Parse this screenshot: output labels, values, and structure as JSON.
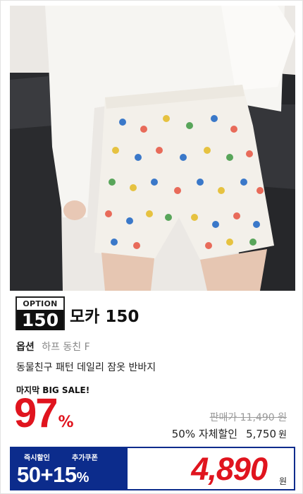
{
  "product_image": {
    "description_icon": "shorts-photo"
  },
  "option": {
    "badge_top": "OPTION",
    "badge_number": "150",
    "name": "모카 150",
    "option_label": "옵션",
    "option_value": "하프 동친 F"
  },
  "description": "동물친구 패턴 데일리 잠옷 반바지",
  "sale": {
    "tag": "마지막 BIG SALE!",
    "discount_number": "97",
    "discount_symbol": "%",
    "original_price": "판매가 11,490 원",
    "self_discount_rate": "50% 자체할인",
    "self_discount_price": "5,750",
    "won": "원"
  },
  "coupon": {
    "label_instant": "즉시할인",
    "label_extra": "추가쿠폰",
    "value": "50+15",
    "value_pct": "%"
  },
  "final": {
    "price": "4,890",
    "won": "원"
  },
  "colors": {
    "accent_red": "#e0141e",
    "coupon_navy": "#0c2c8c"
  }
}
